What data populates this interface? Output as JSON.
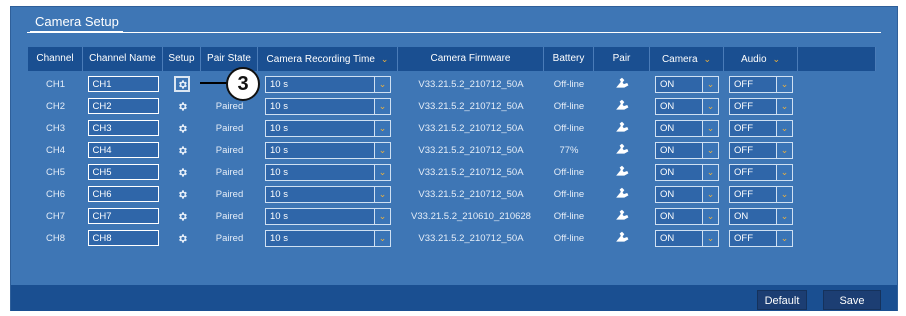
{
  "tab": {
    "label": "Camera Setup"
  },
  "columns": [
    {
      "label": "Channel",
      "dropdown": false
    },
    {
      "label": "Channel Name",
      "dropdown": false
    },
    {
      "label": "Setup",
      "dropdown": false
    },
    {
      "label": "Pair State",
      "dropdown": false
    },
    {
      "label": "Camera Recording Time",
      "dropdown": true
    },
    {
      "label": "Camera Firmware",
      "dropdown": false
    },
    {
      "label": "Battery",
      "dropdown": false
    },
    {
      "label": "Pair",
      "dropdown": false
    },
    {
      "label": "Camera",
      "dropdown": true
    },
    {
      "label": "Audio",
      "dropdown": true
    },
    {
      "label": "",
      "dropdown": false
    }
  ],
  "rows": [
    {
      "channel": "CH1",
      "name": "CH1",
      "pair_state": "",
      "rec_time": "10 s",
      "firmware": "V33.21.5.2_210712_50A",
      "battery": "Off-line",
      "camera": "ON",
      "audio": "OFF"
    },
    {
      "channel": "CH2",
      "name": "CH2",
      "pair_state": "Paired",
      "rec_time": "10 s",
      "firmware": "V33.21.5.2_210712_50A",
      "battery": "Off-line",
      "camera": "ON",
      "audio": "OFF"
    },
    {
      "channel": "CH3",
      "name": "CH3",
      "pair_state": "Paired",
      "rec_time": "10 s",
      "firmware": "V33.21.5.2_210712_50A",
      "battery": "Off-line",
      "camera": "ON",
      "audio": "OFF"
    },
    {
      "channel": "CH4",
      "name": "CH4",
      "pair_state": "Paired",
      "rec_time": "10 s",
      "firmware": "V33.21.5.2_210712_50A",
      "battery": "77%",
      "camera": "ON",
      "audio": "OFF"
    },
    {
      "channel": "CH5",
      "name": "CH5",
      "pair_state": "Paired",
      "rec_time": "10 s",
      "firmware": "V33.21.5.2_210712_50A",
      "battery": "Off-line",
      "camera": "ON",
      "audio": "OFF"
    },
    {
      "channel": "CH6",
      "name": "CH6",
      "pair_state": "Paired",
      "rec_time": "10 s",
      "firmware": "V33.21.5.2_210712_50A",
      "battery": "Off-line",
      "camera": "ON",
      "audio": "OFF"
    },
    {
      "channel": "CH7",
      "name": "CH7",
      "pair_state": "Paired",
      "rec_time": "10 s",
      "firmware": "V33.21.5.2_210610_210628",
      "battery": "Off-line",
      "camera": "ON",
      "audio": "ON"
    },
    {
      "channel": "CH8",
      "name": "CH8",
      "pair_state": "Paired",
      "rec_time": "10 s",
      "firmware": "V33.21.5.2_210712_50A",
      "battery": "Off-line",
      "camera": "ON",
      "audio": "OFF"
    }
  ],
  "callout": {
    "label": "3"
  },
  "buttons": {
    "default": "Default",
    "save": "Save"
  },
  "icons": {
    "setup": "gear-icon",
    "pair": "wrench-icon",
    "dropdown": "chevron-down-icon"
  },
  "colors": {
    "panel": "#3e76b5",
    "header": "#1a4f91",
    "accent": "#f0b23a"
  }
}
